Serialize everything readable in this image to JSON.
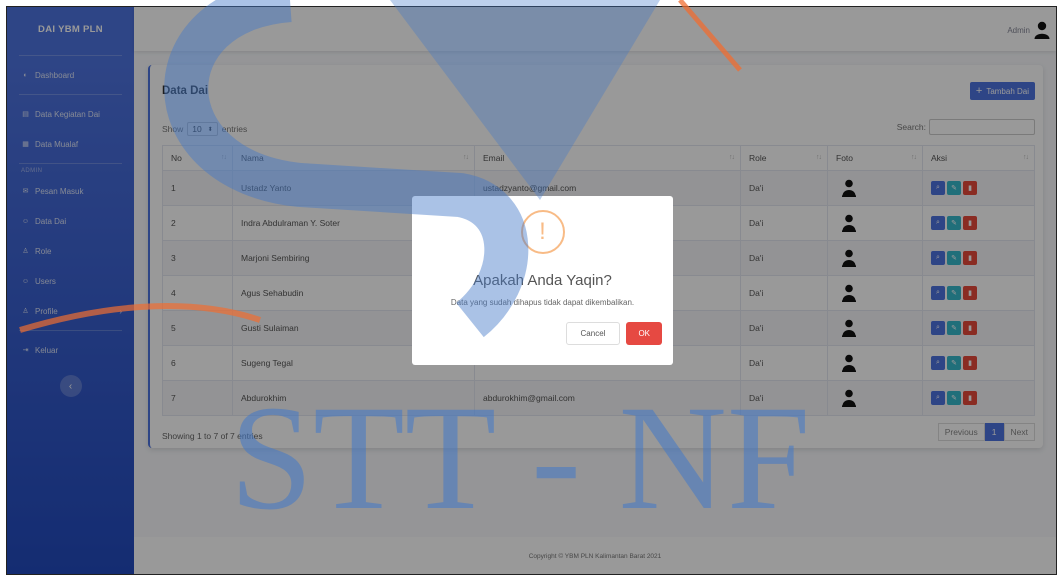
{
  "sidebar": {
    "brand": "DAI YBM PLN",
    "items": [
      {
        "label": "Dashboard"
      },
      {
        "label": "Data Kegiatan Dai"
      },
      {
        "label": "Data Mualaf"
      }
    ],
    "admin_heading": "ADMIN",
    "admin_items": [
      {
        "label": "Pesan Masuk"
      },
      {
        "label": "Data Dai"
      },
      {
        "label": "Role"
      },
      {
        "label": "Users"
      },
      {
        "label": "Profile"
      }
    ],
    "logout": "Keluar",
    "toggle": "‹"
  },
  "topbar": {
    "user": "Admin"
  },
  "card": {
    "title": "Data Dai",
    "add_button": "Tambah Dai",
    "show": "Show",
    "entries_value": "10",
    "entries": "entries",
    "search_label": "Search:",
    "columns": [
      "No",
      "Nama",
      "Email",
      "Role",
      "Foto",
      "Aksi"
    ],
    "rows": [
      {
        "no": "1",
        "nama": "Ustadz Yanto",
        "email": "ustadzyanto@gmail.com",
        "role": "Da'i"
      },
      {
        "no": "2",
        "nama": "Indra Abdulraman Y. Soter",
        "email": "",
        "role": "Da'i"
      },
      {
        "no": "3",
        "nama": "Marjoni Sembiring",
        "email": "",
        "role": "Da'i"
      },
      {
        "no": "4",
        "nama": "Agus Sehabudin",
        "email": "",
        "role": "Da'i"
      },
      {
        "no": "5",
        "nama": "Gusti Sulaiman",
        "email": "",
        "role": "Da'i"
      },
      {
        "no": "6",
        "nama": "Sugeng Tegal",
        "email": "",
        "role": "Da'i"
      },
      {
        "no": "7",
        "nama": "Abdurokhim",
        "email": "abdurokhim@gmail.com",
        "role": "Da'i"
      }
    ],
    "info": "Showing 1 to 7 of 7 entries",
    "pager": {
      "prev": "Previous",
      "page": "1",
      "next": "Next"
    }
  },
  "footer": "Copyright © YBM PLN Kalimantan Barat 2021",
  "modal": {
    "icon": "!",
    "title": "Apakah Anda Yaqin?",
    "text": "Data yang sudah dihapus tidak dapat dikembalikan.",
    "cancel": "Cancel",
    "ok": "OK"
  },
  "watermark": {
    "text": "STT - NF"
  },
  "colors": {
    "primary": "#4e73df",
    "danger": "#e74a3b",
    "info": "#36b9cc",
    "warning_icon": "#f8bb86"
  }
}
